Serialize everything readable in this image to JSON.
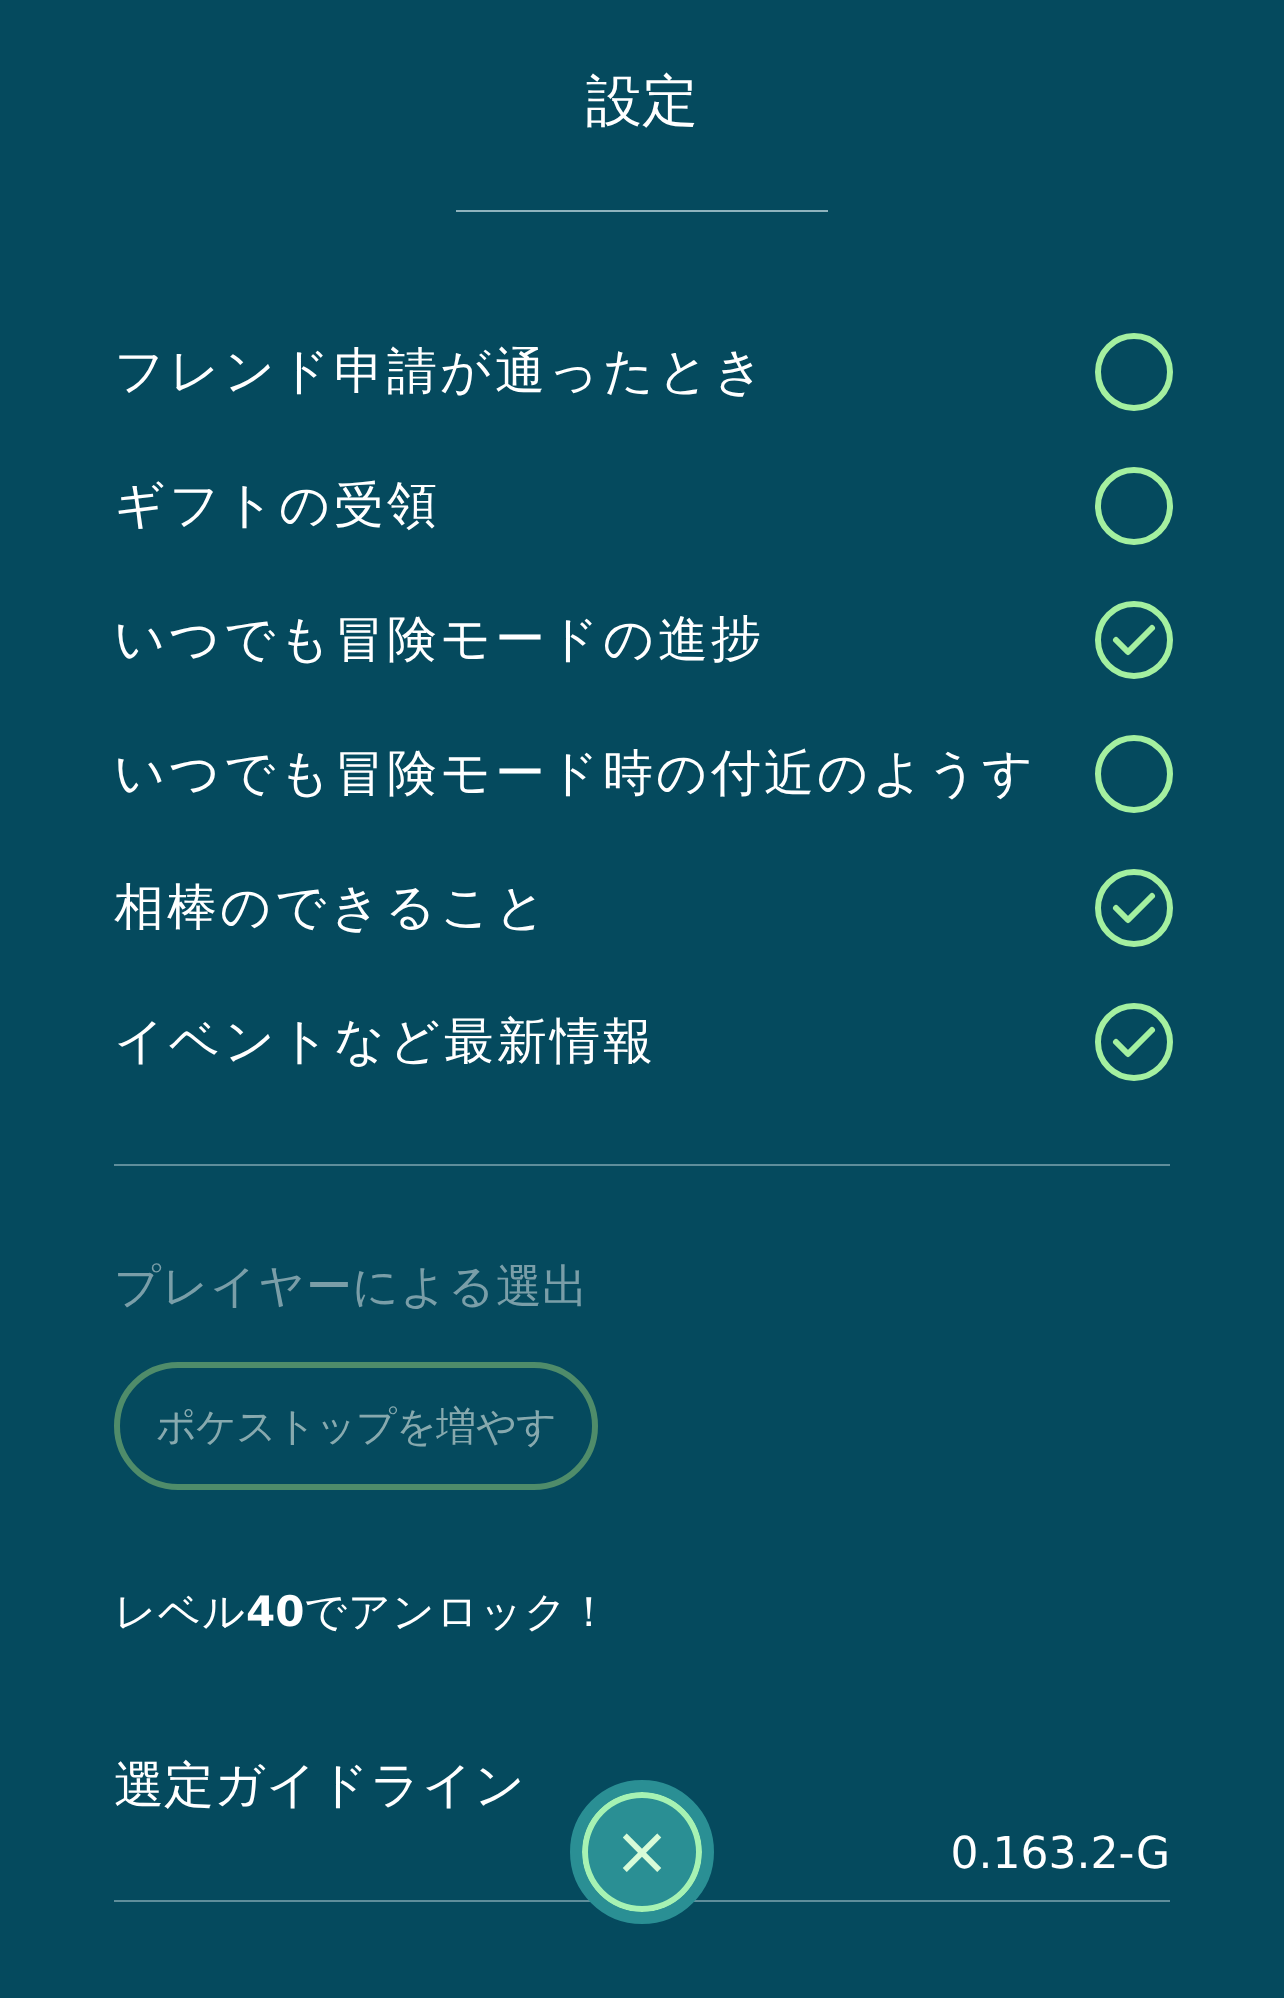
{
  "title": "設定",
  "notifications": [
    {
      "label": "フレンド申請が通ったとき",
      "checked": false
    },
    {
      "label": "ギフトの受領",
      "checked": false
    },
    {
      "label": "いつでも冒険モードの進捗",
      "checked": true
    },
    {
      "label": "いつでも冒険モード時の付近のようす",
      "checked": false
    },
    {
      "label": "相棒のできること",
      "checked": true
    },
    {
      "label": "イベントなど最新情報",
      "checked": true
    }
  ],
  "player_selection": {
    "heading": "プレイヤーによる選出",
    "button": {
      "label": "ポケストップを増やす",
      "disabled": true
    },
    "unlock_note": "レベル**40**でアンロック！"
  },
  "guidelines_link": "選定ガイドライン",
  "version": "0.163.2-G",
  "close_button": "×"
}
